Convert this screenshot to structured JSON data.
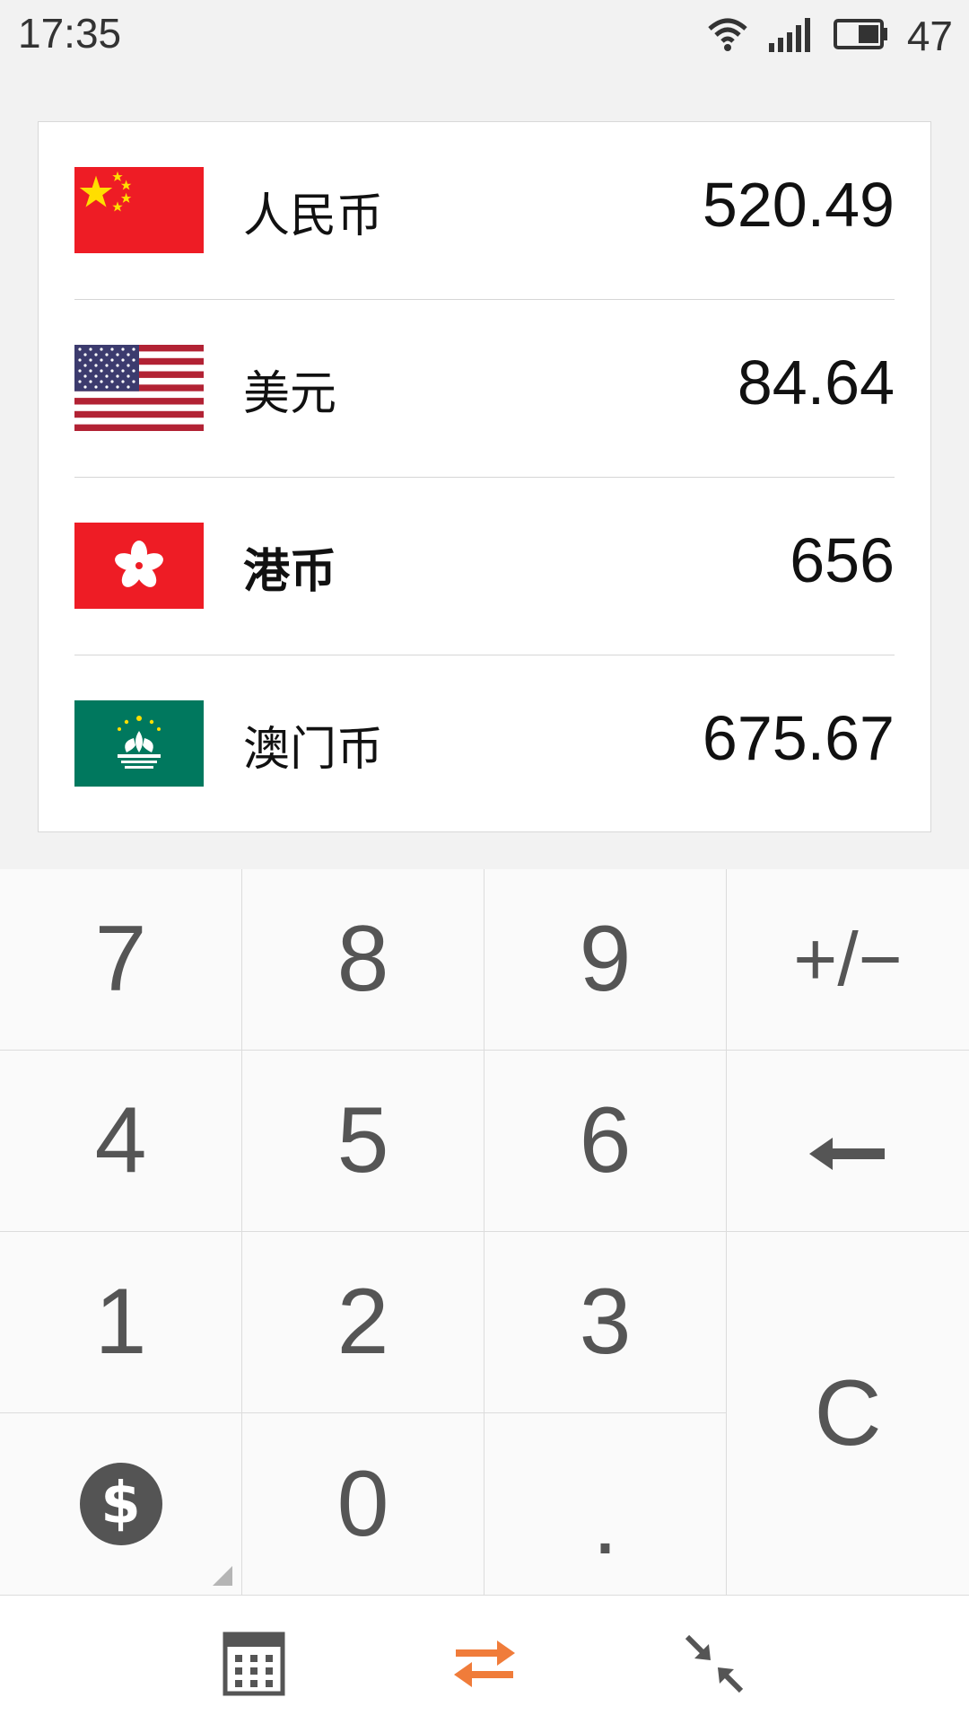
{
  "status_bar": {
    "time": "17:35",
    "battery_level": "47",
    "icons": [
      "wifi-icon",
      "signal-icon",
      "battery-icon"
    ]
  },
  "currencies": [
    {
      "flag": "china-flag",
      "name": "人民币",
      "value": "520.49",
      "active": false
    },
    {
      "flag": "usa-flag",
      "name": "美元",
      "value": "84.64",
      "active": false
    },
    {
      "flag": "hongkong-flag",
      "name": "港币",
      "value": "656",
      "active": true
    },
    {
      "flag": "macau-flag",
      "name": "澳门币",
      "value": "675.67",
      "active": false
    }
  ],
  "keypad": {
    "k7": "7",
    "k8": "8",
    "k9": "9",
    "sign": "+/−",
    "k4": "4",
    "k5": "5",
    "k6": "6",
    "back": "←",
    "k1": "1",
    "k2": "2",
    "k3": "3",
    "clear": "C",
    "currency_symbol": "$",
    "k0": "0",
    "dot": "."
  },
  "bottom_nav": {
    "items": [
      "calculator-icon",
      "swap-icon",
      "collapse-icon"
    ],
    "active": "swap-icon",
    "active_color": "#f07c3a"
  },
  "colors": {
    "key_text": "#555555",
    "divider": "#dcdcdc"
  }
}
